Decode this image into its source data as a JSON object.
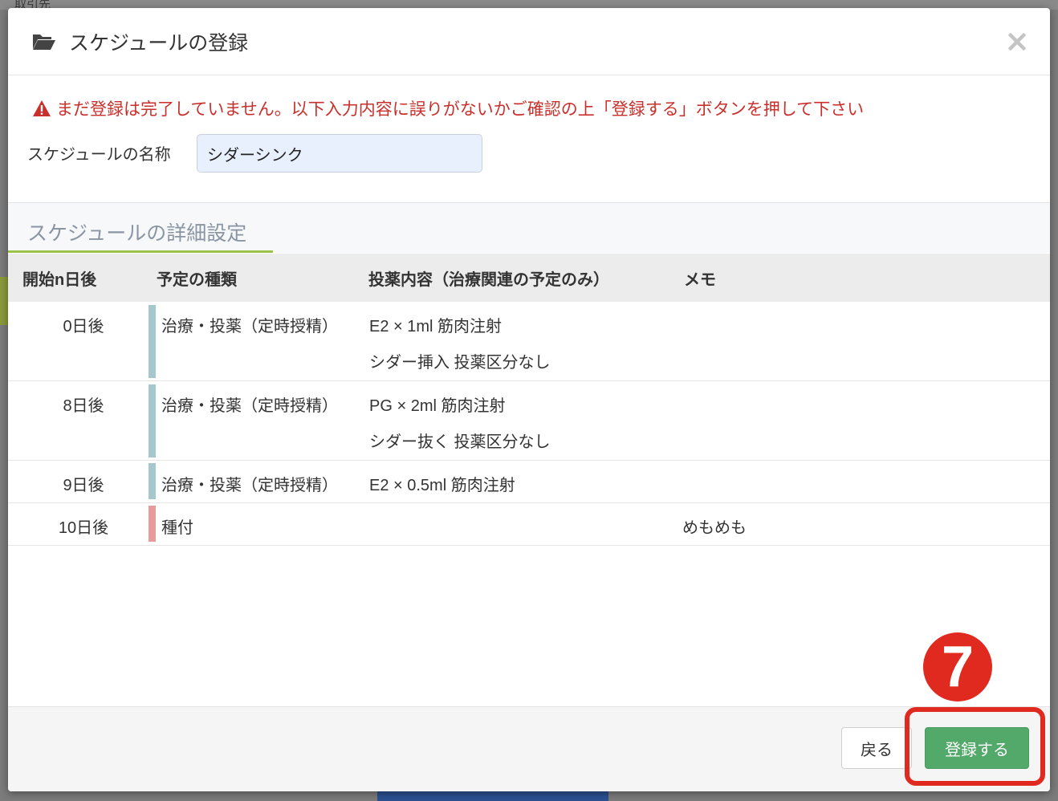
{
  "backdrop": {
    "top_text": "取引先"
  },
  "modal": {
    "title": "スケジュールの登録",
    "icon": "folder-open-icon",
    "close_icon": "close-icon",
    "warning": "まだ登録は完了していません。以下入力内容に誤りがないかご確認の上「登録する」ボタンを押して下さい",
    "name_label": "スケジュールの名称",
    "name_value": "シダーシンク",
    "section_title": "スケジュールの詳細設定",
    "table": {
      "headers": [
        "開始n日後",
        "予定の種類",
        "投薬内容（治療関連の予定のみ）",
        "メモ"
      ],
      "rows": [
        {
          "day": "0日後",
          "type": "治療・投薬（定時授精）",
          "kind": "treatment",
          "content": [
            "E2 × 1ml 筋肉注射",
            "シダー挿入  投薬区分なし"
          ],
          "memo": ""
        },
        {
          "day": "8日後",
          "type": "治療・投薬（定時授精）",
          "kind": "treatment",
          "content": [
            "PG × 2ml 筋肉注射",
            "シダー抜く  投薬区分なし"
          ],
          "memo": ""
        },
        {
          "day": "9日後",
          "type": "治療・投薬（定時授精）",
          "kind": "treatment",
          "content": [
            "E2 × 0.5ml 筋肉注射"
          ],
          "memo": ""
        },
        {
          "day": "10日後",
          "type": "種付",
          "kind": "breeding",
          "content": [],
          "memo": "めもめも"
        }
      ]
    },
    "footer": {
      "back_label": "戻る",
      "register_label": "登録する"
    },
    "step_badge": "7"
  },
  "colors": {
    "warning": "#c9302c",
    "register_button": "#52a96a",
    "highlight": "#e02a1f",
    "treatment_bar": "#a4c8cc",
    "breeding_bar": "#e99a9a",
    "section_underline": "#9bc34a"
  }
}
